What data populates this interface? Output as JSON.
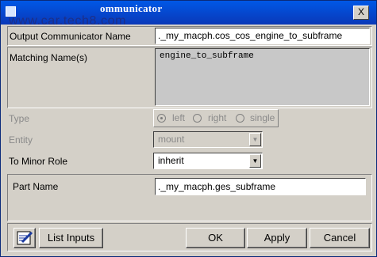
{
  "window": {
    "title": "ommunicator",
    "watermark": "www.car.tech8.com",
    "close_label": "X"
  },
  "output_communicator": {
    "label": "Output Communicator Name",
    "value": "._my_macph.cos_cos_engine_to_subframe"
  },
  "matching_names": {
    "label": "Matching Name(s)",
    "value": "engine_to_subframe"
  },
  "type": {
    "label": "Type",
    "options": [
      "left",
      "right",
      "single"
    ],
    "selected": "left"
  },
  "entity": {
    "label": "Entity",
    "value": "mount"
  },
  "to_minor_role": {
    "label": "To Minor Role",
    "value": "inherit"
  },
  "part_name": {
    "label": "Part Name",
    "value": "._my_macph.ges_subframe"
  },
  "buttons": {
    "list_inputs": "List Inputs",
    "ok": "OK",
    "apply": "Apply",
    "cancel": "Cancel"
  },
  "icons": {
    "pen": "pen-icon",
    "dropdown": "chevron-down-icon"
  }
}
